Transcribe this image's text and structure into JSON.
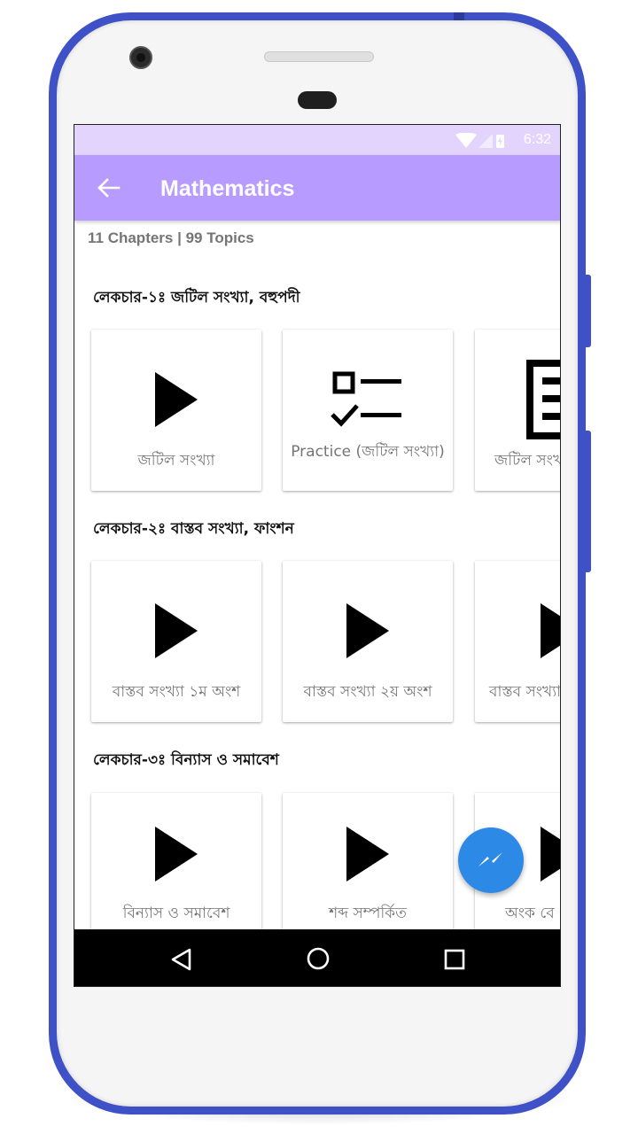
{
  "status_bar": {
    "time": "6:32"
  },
  "app_bar": {
    "title": "Mathematics"
  },
  "summary": "11 Chapters | 99 Topics",
  "chapters": [
    {
      "title": "লেকচার-১ঃ জটিল সংখ্যা, বহুপদী",
      "cards": [
        {
          "icon": "play-icon",
          "label": "জটিল সংখ্যা"
        },
        {
          "icon": "checklist-icon",
          "label": "Practice (জটিল সংখ্যা)"
        },
        {
          "icon": "document-icon",
          "label": "জটিল সংখ্যা"
        }
      ]
    },
    {
      "title": "লেকচার-২ঃ বাস্তব সংখ্যা, ফাংশন",
      "cards": [
        {
          "icon": "play-icon",
          "label": "বাস্তব সংখ্যা ১ম অংশ"
        },
        {
          "icon": "play-icon",
          "label": "বাস্তব সংখ্যা ২য় অংশ"
        },
        {
          "icon": "play-icon",
          "label": "বাস্তব সংখ্যা"
        }
      ]
    },
    {
      "title": "লেকচার-৩ঃ বিন্যাস ও সমাবেশ",
      "cards": [
        {
          "icon": "play-icon",
          "label": "বিন্যাস ও সমাবেশ"
        },
        {
          "icon": "play-icon",
          "label": "শব্দ সম্পর্কিত"
        },
        {
          "icon": "play-icon",
          "label": "অংক বে"
        }
      ]
    }
  ],
  "fab": {
    "icon": "messenger-icon"
  },
  "colors": {
    "status_bar": "#e3d4fe",
    "app_bar": "#b89bfe",
    "fab": "#2d89e6",
    "phone_frame": "#3f51c6"
  }
}
